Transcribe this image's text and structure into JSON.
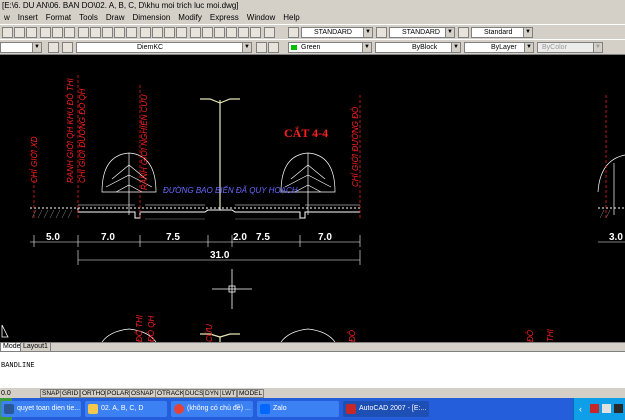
{
  "window": {
    "title": "[E:\\6. DU AN\\06. BAN DO\\02. A, B, C, D\\khu moi trich luc moi.dwg]"
  },
  "menu": {
    "items": [
      "w",
      "Insert",
      "Format",
      "Tools",
      "Draw",
      "Dimension",
      "Modify",
      "Express",
      "Window",
      "Help"
    ]
  },
  "toolbar": {
    "text_style": "STANDARD",
    "dim_style": "STANDARD",
    "table_style": "Standard",
    "layer": "DiemKC",
    "color": "Green",
    "linetype": "ByBlock",
    "lineweight": "ByLayer",
    "plotstyle": "ByColor"
  },
  "drawing": {
    "section_title": "CẮT 4-4",
    "road_label": "ĐƯỜNG BAO BIỂN ĐÃ QUY HOẠCH",
    "vertical_labels": [
      "CHỈ GIỚI XD",
      "RANH GIỚI QH KHU ĐÔ THỊ",
      "CHỈ GIỚI ĐƯỜNG ĐỎ QH",
      "RANH GIỚI NGHIÊN CỨU",
      "CHỈ GIỚI ĐƯỜNG ĐỎ"
    ],
    "dimensions": [
      "5.0",
      "7.0",
      "7.5",
      "2.0",
      "7.5",
      "7.0"
    ],
    "total": "31.0",
    "right_dimension": "3.0",
    "lower_labels": [
      "ĐÔ THỊ",
      "ĐỎ QH",
      "CỨU",
      "ĐÔ",
      "ĐỎ",
      "THỊ"
    ]
  },
  "tabs": {
    "model": "Model",
    "layout1": "Layout1"
  },
  "command": {
    "text": "BANDLINE"
  },
  "status": {
    "coords": "0.0",
    "buttons": [
      "SNAP",
      "GRID",
      "ORTHO",
      "POLAR",
      "OSNAP",
      "OTRACK",
      "DUCS",
      "DYN",
      "LWT",
      "MODEL"
    ]
  },
  "taskbar": {
    "tasks": [
      {
        "label": "quyet toan dien tie...",
        "icon_color": "#2b5797"
      },
      {
        "label": "02. A, B, C, D",
        "icon_color": "#f2c94c"
      },
      {
        "label": "(không có chủ đề) ...",
        "icon_color": "#e34234"
      },
      {
        "label": "Zalo",
        "icon_color": "#0068ff"
      },
      {
        "label": "AutoCAD 2007 - [E:...",
        "icon_color": "#c62828"
      }
    ]
  },
  "colors": {
    "drawing_text": "#ff2020",
    "road_text": "#6a6aff",
    "drawing_lines": "#ffffff",
    "pole": "#e6e6b4",
    "color_swatch": "#00c000"
  }
}
